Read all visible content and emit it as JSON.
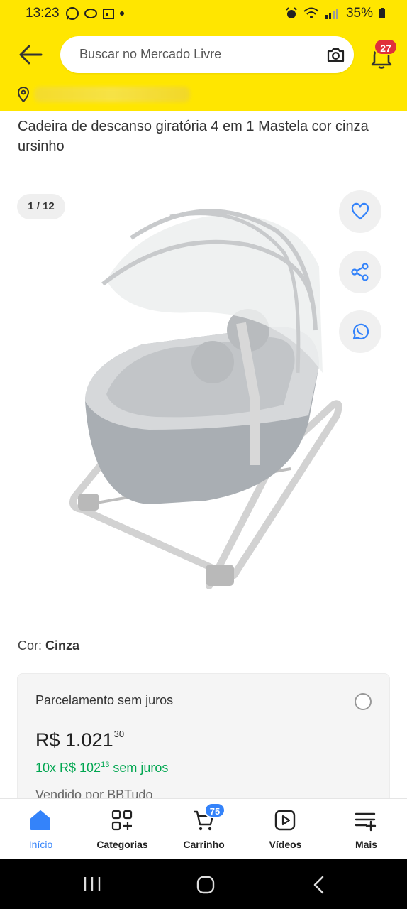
{
  "status_bar": {
    "time": "13:23",
    "battery": "35%"
  },
  "header": {
    "search_placeholder": "Buscar no Mercado Livre",
    "notifications_count": "27"
  },
  "product": {
    "title": "Cadeira de descanso giratória 4 em 1 Mastela cor cinza ursinho",
    "gallery_counter": "1 / 12",
    "color_label": "Cor:",
    "color_value": "Cinza"
  },
  "payment": {
    "heading": "Parcelamento sem juros",
    "price_main": "R$ 1.021",
    "price_cents": "30",
    "installments_prefix": "10x R$ 102",
    "installments_cents": "13",
    "installments_suffix": " sem juros",
    "seller": "Vendido por BBTudo"
  },
  "bottom_nav": {
    "items": [
      {
        "label": "Início",
        "icon": "home-icon"
      },
      {
        "label": "Categorias",
        "icon": "categories-icon"
      },
      {
        "label": "Carrinho",
        "icon": "cart-icon",
        "badge": "75"
      },
      {
        "label": "Vídeos",
        "icon": "video-icon"
      },
      {
        "label": "Mais",
        "icon": "menu-plus-icon"
      }
    ]
  },
  "colors": {
    "brand_yellow": "#ffe600",
    "accent_blue": "#3483fa",
    "success_green": "#00a650",
    "badge_red": "#e02f3b"
  }
}
